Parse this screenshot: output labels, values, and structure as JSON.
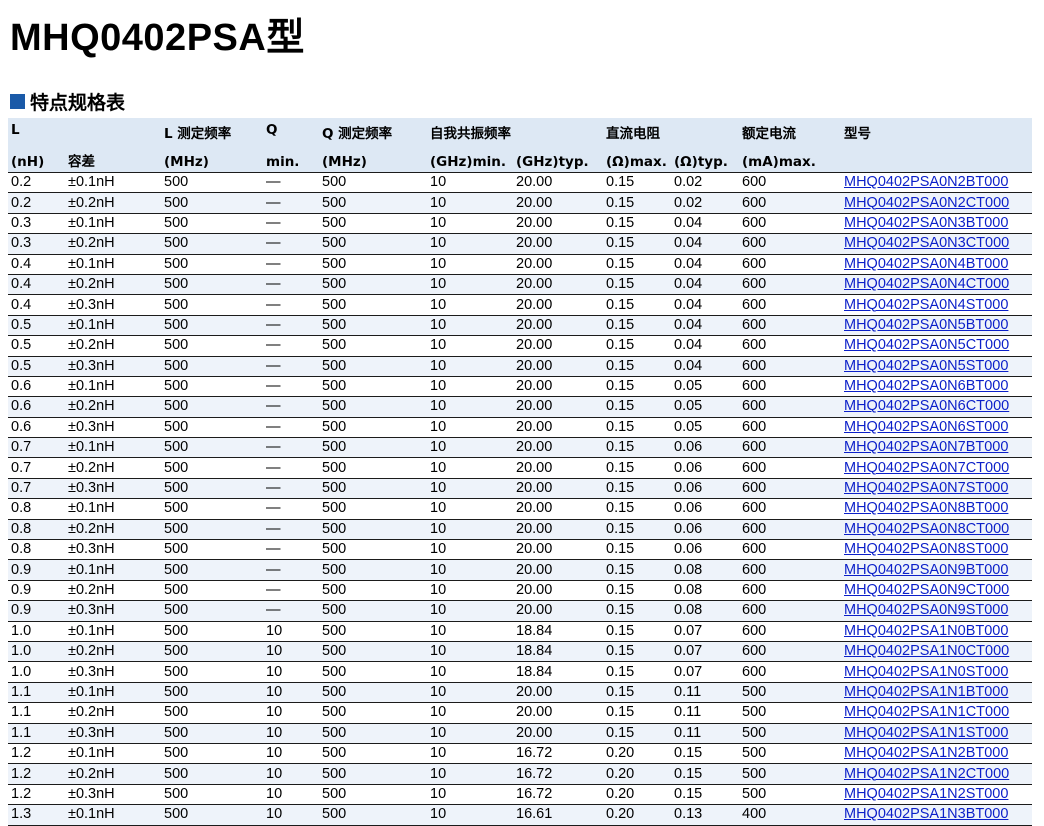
{
  "title": "MHQ0402PSA型",
  "section_title": "特点规格表",
  "header": {
    "row1": [
      "L",
      "",
      "L 测定频率",
      "Q",
      "Q 测定频率",
      "自我共振频率",
      "",
      "直流电阻",
      "",
      "额定电流",
      "型号"
    ],
    "row2": [
      "(nH)",
      "容差",
      "(MHz)",
      "min.",
      "(MHz)",
      "(GHz)min.",
      "(GHz)typ.",
      "(Ω)max.",
      "(Ω)typ.",
      "(mA)max.",
      ""
    ]
  },
  "rows": [
    [
      "0.2",
      "±0.1nH",
      "500",
      "—",
      "500",
      "10",
      "20.00",
      "0.15",
      "0.02",
      "600",
      "MHQ0402PSA0N2BT000"
    ],
    [
      "0.2",
      "±0.2nH",
      "500",
      "—",
      "500",
      "10",
      "20.00",
      "0.15",
      "0.02",
      "600",
      "MHQ0402PSA0N2CT000"
    ],
    [
      "0.3",
      "±0.1nH",
      "500",
      "—",
      "500",
      "10",
      "20.00",
      "0.15",
      "0.04",
      "600",
      "MHQ0402PSA0N3BT000"
    ],
    [
      "0.3",
      "±0.2nH",
      "500",
      "—",
      "500",
      "10",
      "20.00",
      "0.15",
      "0.04",
      "600",
      "MHQ0402PSA0N3CT000"
    ],
    [
      "0.4",
      "±0.1nH",
      "500",
      "—",
      "500",
      "10",
      "20.00",
      "0.15",
      "0.04",
      "600",
      "MHQ0402PSA0N4BT000"
    ],
    [
      "0.4",
      "±0.2nH",
      "500",
      "—",
      "500",
      "10",
      "20.00",
      "0.15",
      "0.04",
      "600",
      "MHQ0402PSA0N4CT000"
    ],
    [
      "0.4",
      "±0.3nH",
      "500",
      "—",
      "500",
      "10",
      "20.00",
      "0.15",
      "0.04",
      "600",
      "MHQ0402PSA0N4ST000"
    ],
    [
      "0.5",
      "±0.1nH",
      "500",
      "—",
      "500",
      "10",
      "20.00",
      "0.15",
      "0.04",
      "600",
      "MHQ0402PSA0N5BT000"
    ],
    [
      "0.5",
      "±0.2nH",
      "500",
      "—",
      "500",
      "10",
      "20.00",
      "0.15",
      "0.04",
      "600",
      "MHQ0402PSA0N5CT000"
    ],
    [
      "0.5",
      "±0.3nH",
      "500",
      "—",
      "500",
      "10",
      "20.00",
      "0.15",
      "0.04",
      "600",
      "MHQ0402PSA0N5ST000"
    ],
    [
      "0.6",
      "±0.1nH",
      "500",
      "—",
      "500",
      "10",
      "20.00",
      "0.15",
      "0.05",
      "600",
      "MHQ0402PSA0N6BT000"
    ],
    [
      "0.6",
      "±0.2nH",
      "500",
      "—",
      "500",
      "10",
      "20.00",
      "0.15",
      "0.05",
      "600",
      "MHQ0402PSA0N6CT000"
    ],
    [
      "0.6",
      "±0.3nH",
      "500",
      "—",
      "500",
      "10",
      "20.00",
      "0.15",
      "0.05",
      "600",
      "MHQ0402PSA0N6ST000"
    ],
    [
      "0.7",
      "±0.1nH",
      "500",
      "—",
      "500",
      "10",
      "20.00",
      "0.15",
      "0.06",
      "600",
      "MHQ0402PSA0N7BT000"
    ],
    [
      "0.7",
      "±0.2nH",
      "500",
      "—",
      "500",
      "10",
      "20.00",
      "0.15",
      "0.06",
      "600",
      "MHQ0402PSA0N7CT000"
    ],
    [
      "0.7",
      "±0.3nH",
      "500",
      "—",
      "500",
      "10",
      "20.00",
      "0.15",
      "0.06",
      "600",
      "MHQ0402PSA0N7ST000"
    ],
    [
      "0.8",
      "±0.1nH",
      "500",
      "—",
      "500",
      "10",
      "20.00",
      "0.15",
      "0.06",
      "600",
      "MHQ0402PSA0N8BT000"
    ],
    [
      "0.8",
      "±0.2nH",
      "500",
      "—",
      "500",
      "10",
      "20.00",
      "0.15",
      "0.06",
      "600",
      "MHQ0402PSA0N8CT000"
    ],
    [
      "0.8",
      "±0.3nH",
      "500",
      "—",
      "500",
      "10",
      "20.00",
      "0.15",
      "0.06",
      "600",
      "MHQ0402PSA0N8ST000"
    ],
    [
      "0.9",
      "±0.1nH",
      "500",
      "—",
      "500",
      "10",
      "20.00",
      "0.15",
      "0.08",
      "600",
      "MHQ0402PSA0N9BT000"
    ],
    [
      "0.9",
      "±0.2nH",
      "500",
      "—",
      "500",
      "10",
      "20.00",
      "0.15",
      "0.08",
      "600",
      "MHQ0402PSA0N9CT000"
    ],
    [
      "0.9",
      "±0.3nH",
      "500",
      "—",
      "500",
      "10",
      "20.00",
      "0.15",
      "0.08",
      "600",
      "MHQ0402PSA0N9ST000"
    ],
    [
      "1.0",
      "±0.1nH",
      "500",
      "10",
      "500",
      "10",
      "18.84",
      "0.15",
      "0.07",
      "600",
      "MHQ0402PSA1N0BT000"
    ],
    [
      "1.0",
      "±0.2nH",
      "500",
      "10",
      "500",
      "10",
      "18.84",
      "0.15",
      "0.07",
      "600",
      "MHQ0402PSA1N0CT000"
    ],
    [
      "1.0",
      "±0.3nH",
      "500",
      "10",
      "500",
      "10",
      "18.84",
      "0.15",
      "0.07",
      "600",
      "MHQ0402PSA1N0ST000"
    ],
    [
      "1.1",
      "±0.1nH",
      "500",
      "10",
      "500",
      "10",
      "20.00",
      "0.15",
      "0.11",
      "500",
      "MHQ0402PSA1N1BT000"
    ],
    [
      "1.1",
      "±0.2nH",
      "500",
      "10",
      "500",
      "10",
      "20.00",
      "0.15",
      "0.11",
      "500",
      "MHQ0402PSA1N1CT000"
    ],
    [
      "1.1",
      "±0.3nH",
      "500",
      "10",
      "500",
      "10",
      "20.00",
      "0.15",
      "0.11",
      "500",
      "MHQ0402PSA1N1ST000"
    ],
    [
      "1.2",
      "±0.1nH",
      "500",
      "10",
      "500",
      "10",
      "16.72",
      "0.20",
      "0.15",
      "500",
      "MHQ0402PSA1N2BT000"
    ],
    [
      "1.2",
      "±0.2nH",
      "500",
      "10",
      "500",
      "10",
      "16.72",
      "0.20",
      "0.15",
      "500",
      "MHQ0402PSA1N2CT000"
    ],
    [
      "1.2",
      "±0.3nH",
      "500",
      "10",
      "500",
      "10",
      "16.72",
      "0.20",
      "0.15",
      "500",
      "MHQ0402PSA1N2ST000"
    ],
    [
      "1.3",
      "±0.1nH",
      "500",
      "10",
      "500",
      "10",
      "16.61",
      "0.20",
      "0.13",
      "400",
      "MHQ0402PSA1N3BT000"
    ]
  ],
  "colors": {
    "accent": "#1a5aa8",
    "header_bg": "#dde8f4",
    "link": "#0b1fc9"
  }
}
